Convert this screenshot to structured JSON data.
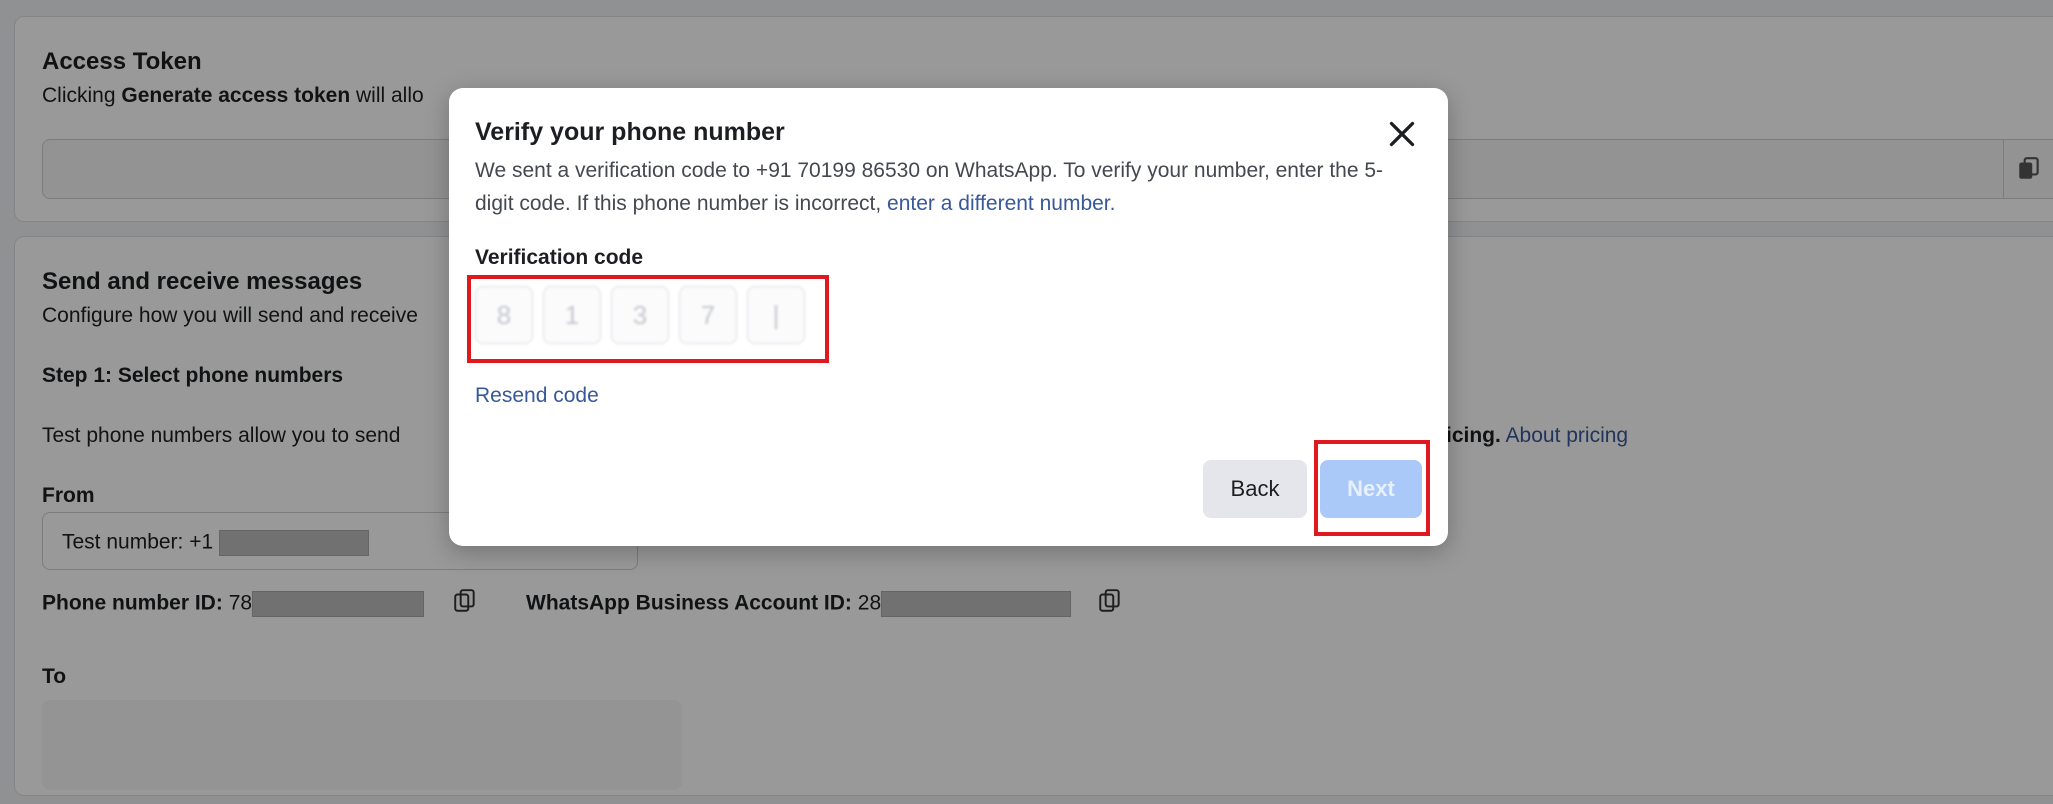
{
  "background": {
    "access_token": {
      "title": "Access Token",
      "desc_prefix": "Clicking ",
      "desc_bold": "Generate access token",
      "desc_suffix": " will allo"
    },
    "send_receive": {
      "title": "Send and receive messages",
      "subtitle": "Configure how you will send and receive",
      "step1": "Step 1: Select phone numbers",
      "test_desc": "Test phone numbers allow you to send",
      "pricing_bold": "icing.",
      "pricing_link": "About pricing",
      "from_label": "From",
      "from_value": "Test number: +1",
      "phone_id_label": "Phone number ID:",
      "phone_id_partial": "78",
      "waba_id_label": "WhatsApp Business Account ID:",
      "waba_id_partial": "28",
      "to_label": "To"
    }
  },
  "modal": {
    "title": "Verify your phone number",
    "desc_main": "We sent a verification code to +91 70199 86530 on WhatsApp. To verify your number, enter the 5-digit code. If this phone number is incorrect, ",
    "desc_link": "enter a different number.",
    "code_label": "Verification code",
    "code_digits": [
      "8",
      "1",
      "3",
      "7",
      "|"
    ],
    "resend_label": "Resend code",
    "back_label": "Back",
    "next_label": "Next"
  },
  "colors": {
    "link": "#385898",
    "highlight": "#e0191f",
    "next_button_disabled": "#aac8f8"
  }
}
